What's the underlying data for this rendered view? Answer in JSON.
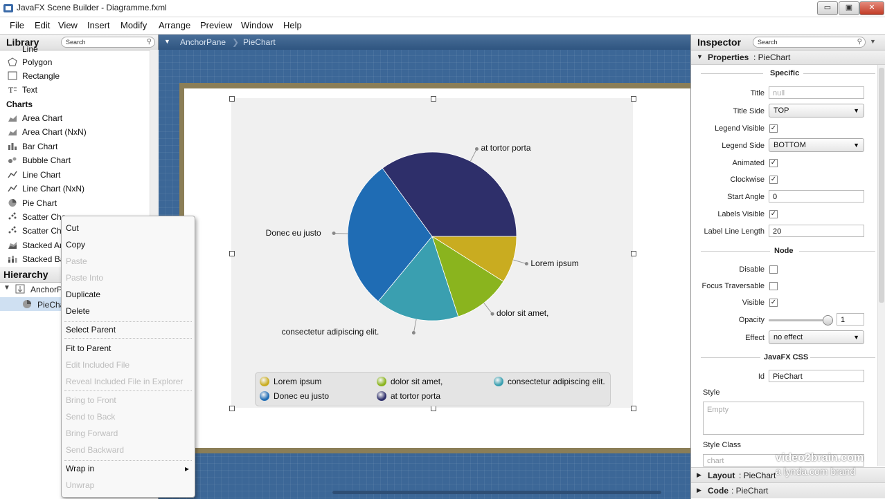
{
  "window": {
    "title": "JavaFX Scene Builder - Diagramme.fxml",
    "minimize": "▭",
    "maximize": "▣",
    "close": "✕"
  },
  "menu": [
    "File",
    "Edit",
    "View",
    "Insert",
    "Modify",
    "Arrange",
    "Preview",
    "Window",
    "Help"
  ],
  "library": {
    "title": "Library",
    "search_placeholder": "Search",
    "items_top": [
      {
        "label": "Line",
        "icon": "line-icon"
      },
      {
        "label": "Polygon",
        "icon": "polygon-icon"
      },
      {
        "label": "Rectangle",
        "icon": "rectangle-icon"
      },
      {
        "label": "Text",
        "icon": "text-icon"
      }
    ],
    "category": "Charts",
    "charts": [
      {
        "label": "Area Chart",
        "icon": "area-chart-icon"
      },
      {
        "label": "Area Chart (NxN)",
        "icon": "area-chart-icon"
      },
      {
        "label": "Bar Chart",
        "icon": "bar-chart-icon"
      },
      {
        "label": "Bubble Chart",
        "icon": "bubble-chart-icon"
      },
      {
        "label": "Line Chart",
        "icon": "line-chart-icon"
      },
      {
        "label": "Line Chart (NxN)",
        "icon": "line-chart-icon"
      },
      {
        "label": "Pie Chart",
        "icon": "pie-chart-icon"
      },
      {
        "label": "Scatter Cha",
        "icon": "scatter-chart-icon"
      },
      {
        "label": "Scatter Cha",
        "icon": "scatter-chart-icon"
      },
      {
        "label": "Stacked Ar",
        "icon": "stacked-area-icon"
      },
      {
        "label": "Stacked Ba",
        "icon": "stacked-bar-icon"
      }
    ]
  },
  "hierarchy": {
    "title": "Hierarchy",
    "nodes": [
      {
        "label": "AnchorP",
        "icon": "anchorpane-icon"
      },
      {
        "label": "PieChar",
        "icon": "pie-chart-icon"
      }
    ]
  },
  "breadcrumb": [
    "AnchorPane",
    "PieChart"
  ],
  "context_menu": [
    {
      "label": "Cut",
      "enabled": true
    },
    {
      "label": "Copy",
      "enabled": true
    },
    {
      "label": "Paste",
      "enabled": false
    },
    {
      "label": "Paste Into",
      "enabled": false
    },
    {
      "label": "Duplicate",
      "enabled": true
    },
    {
      "label": "Delete",
      "enabled": true
    },
    {
      "label": "Select Parent",
      "enabled": true
    },
    {
      "label": "Fit to Parent",
      "enabled": true
    },
    {
      "label": "Edit Included File",
      "enabled": false
    },
    {
      "label": "Reveal Included File in Explorer",
      "enabled": false
    },
    {
      "label": "Bring to Front",
      "enabled": false
    },
    {
      "label": "Send to Back",
      "enabled": false
    },
    {
      "label": "Bring Forward",
      "enabled": false
    },
    {
      "label": "Send Backward",
      "enabled": false
    },
    {
      "label": "Wrap in",
      "enabled": true,
      "submenu_arrow": "▸"
    },
    {
      "label": "Unwrap",
      "enabled": false
    }
  ],
  "chart_data": {
    "type": "pie",
    "title": "",
    "legend_side": "bottom",
    "clockwise": true,
    "start_angle": 0,
    "slices": [
      {
        "label": "Lorem ipsum",
        "value": 9,
        "color": "#c9ac20"
      },
      {
        "label": "dolor sit amet,",
        "value": 11,
        "color": "#8ab41e"
      },
      {
        "label": "consectetur adipiscing elit.",
        "value": 16,
        "color": "#3a9fb0"
      },
      {
        "label": "Donec eu justo",
        "value": 29,
        "color": "#1f6cb4"
      },
      {
        "label": "at tortor porta",
        "value": 35,
        "color": "#2e2f6a"
      }
    ]
  },
  "inspector": {
    "title": "Inspector",
    "search_placeholder": "Search",
    "properties_header": "Properties",
    "properties_target": ": PieChart",
    "sections": {
      "specific": "Specific",
      "node": "Node",
      "css": "JavaFX CSS"
    },
    "title_label": "Title",
    "title_placeholder": "null",
    "title_side_label": "Title Side",
    "title_side": "TOP",
    "legend_visible_label": "Legend Visible",
    "legend_side_label": "Legend Side",
    "legend_side": "BOTTOM",
    "animated_label": "Animated",
    "clockwise_label": "Clockwise",
    "start_angle_label": "Start Angle",
    "start_angle": "0",
    "labels_visible_label": "Labels Visible",
    "label_line_length_label": "Label Line Length",
    "label_line_length": "20",
    "disable_label": "Disable",
    "focus_traversable_label": "Focus Traversable",
    "visible_label": "Visible",
    "opacity_label": "Opacity",
    "opacity": "1",
    "effect_label": "Effect",
    "effect": "no effect",
    "id_label": "Id",
    "id": "PieChart",
    "style_label": "Style",
    "style_placeholder": "Empty",
    "style_class_label": "Style Class",
    "style_class": "chart",
    "check": "✓",
    "layout_header": "Layout",
    "layout_target": ": PieChart",
    "code_header": "Code",
    "code_target": ": PieChart"
  },
  "watermark": {
    "line1": "video2brain.com",
    "line2": "a lynda.com brand"
  }
}
